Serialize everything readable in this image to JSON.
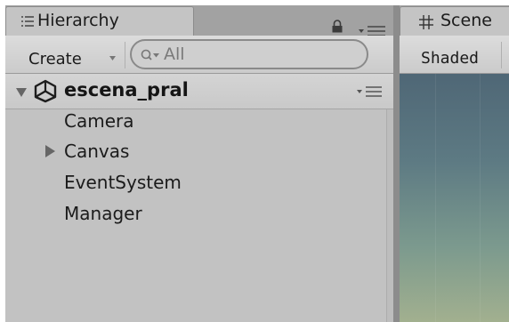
{
  "hierarchy_panel": {
    "tab_label": "Hierarchy",
    "tab_icon": "list-icon",
    "lock_icon": "lock-icon",
    "menu_icon": "panel-menu-icon",
    "create_button_label": "Create",
    "search": {
      "value": "",
      "placeholder": "All",
      "icon": "search-filter-icon"
    },
    "scene": {
      "name": "escena_pral",
      "icon": "unity-logo-icon",
      "expanded": true
    },
    "items": [
      {
        "label": "Camera",
        "has_children": false
      },
      {
        "label": "Canvas",
        "has_children": true,
        "expanded": false
      },
      {
        "label": "EventSystem",
        "has_children": false
      },
      {
        "label": "Manager",
        "has_children": false
      }
    ]
  },
  "scene_panel": {
    "tab_label": "Scene",
    "tab_icon": "hash-icon",
    "shading_mode": "Shaded"
  },
  "colors": {
    "panel_background": "#c2c2c2",
    "tab_strip": "#a2a2a2",
    "viewport_sky": "#4f6776",
    "viewport_ground": "#a2b08f"
  }
}
